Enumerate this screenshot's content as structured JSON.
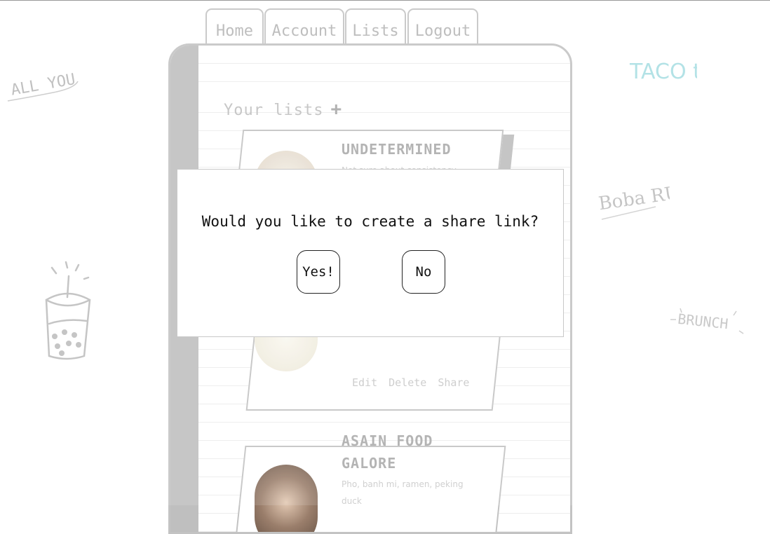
{
  "nav": {
    "home": "Home",
    "account": "Account",
    "lists": "Lists",
    "logout": "Logout"
  },
  "section": {
    "title": "Your lists",
    "add_icon": "plus-icon"
  },
  "lists": [
    {
      "title": "UNDETERMINED",
      "description": "Not sure about consistency"
    },
    {
      "actions": {
        "edit": "Edit",
        "delete": "Delete",
        "share": "Share"
      }
    },
    {
      "title_line1": "ASAIN FOOD",
      "title_line2": "GALORE",
      "description_line1": "Pho, banh mi, ramen, peking",
      "description_line2": "duck"
    }
  ],
  "doodles": {
    "all_you_can_eat": "ALL YOU can EAT",
    "taco_tuesday": "TACO tuesday",
    "boba_run": "Boba RUN",
    "brunch": "BRUNCH",
    "boba_cup": "boba-cup-icon"
  },
  "modal": {
    "question": "Would you like to create a share link?",
    "yes": "Yes!",
    "no": "No"
  },
  "colors": {
    "accent_taco": "#a9dfe3",
    "line": "#c3c3c3",
    "spine": "#bfbfbf"
  }
}
